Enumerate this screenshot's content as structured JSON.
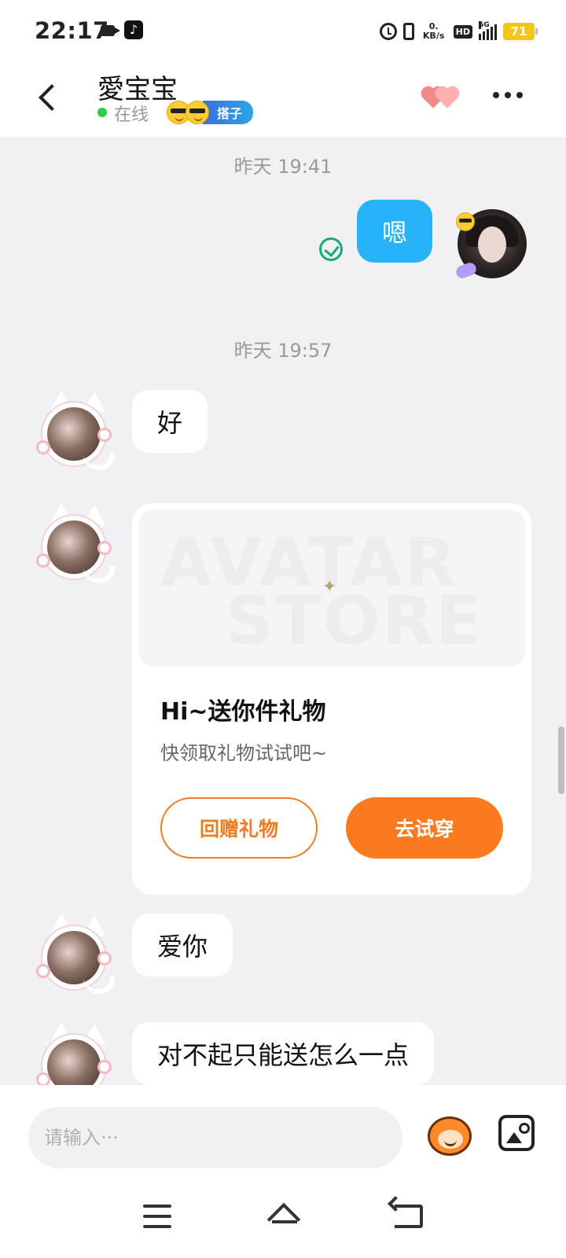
{
  "status_bar": {
    "time": "22:17",
    "net_speed_top": "0.",
    "net_speed_bottom": "KB/s",
    "hd": "HD",
    "network": "5G",
    "battery": "71"
  },
  "header": {
    "title": "愛宝宝",
    "status": "在线",
    "badge_label": "搭子"
  },
  "chat": {
    "messages": [
      {
        "type": "timestamp",
        "text": "昨天 19:41"
      },
      {
        "type": "sent",
        "text": "嗯"
      },
      {
        "type": "timestamp",
        "text": "昨天 19:57"
      },
      {
        "type": "received",
        "text": "好"
      },
      {
        "type": "gift_card",
        "banner_line1": "AVATAR",
        "banner_line2": "STORE",
        "title": "Hi~送你件礼物",
        "subtitle": "快领取礼物试试吧~",
        "return_button": "回赠礼物",
        "try_button": "去试穿"
      },
      {
        "type": "received",
        "text": "爱你"
      },
      {
        "type": "received",
        "text": "对不起只能送怎么一点"
      }
    ]
  },
  "input": {
    "placeholder": "请输入···"
  },
  "icons": {
    "back": "chevron-left-icon",
    "hearts": "hearts-icon",
    "more": "more-dots-icon",
    "sent_status": "check-circle-icon",
    "mascot": "mascot-emoji-icon",
    "image": "image-icon",
    "nav_menu": "menu-icon",
    "nav_home": "home-icon",
    "nav_back": "back-icon"
  },
  "colors": {
    "sent_bubble": "#27b3f7",
    "accent_orange": "#fb7a1d",
    "online_green": "#2ecc40",
    "check_green": "#18a77a"
  }
}
